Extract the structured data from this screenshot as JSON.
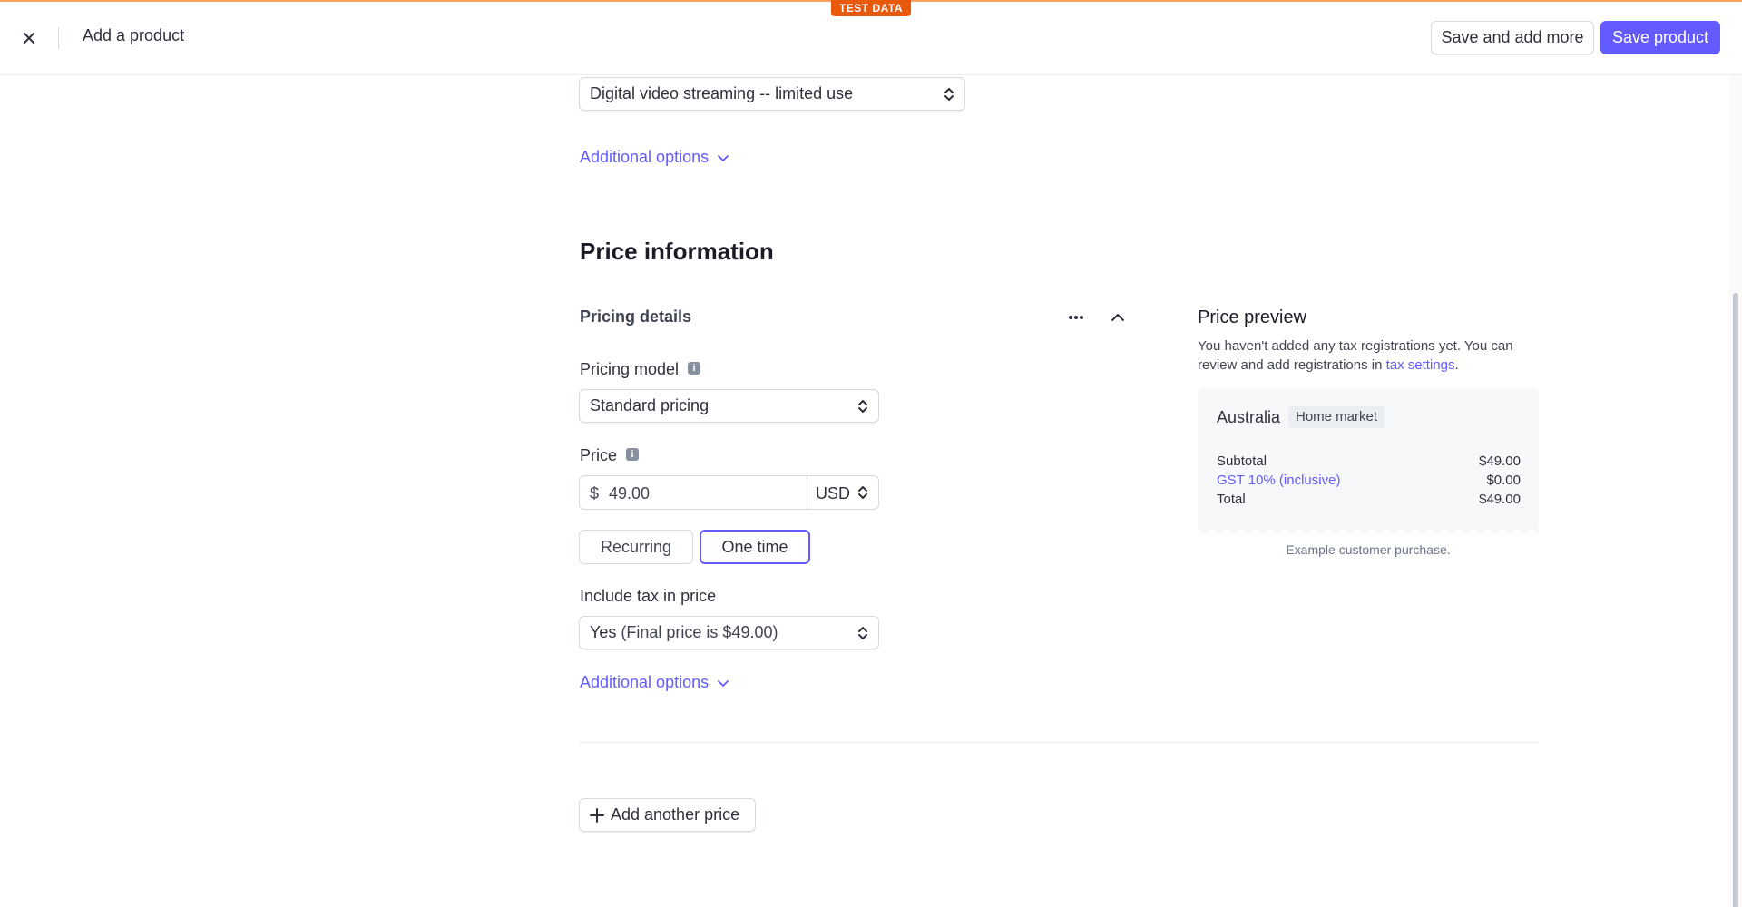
{
  "badge": {
    "test_data": "TEST DATA"
  },
  "header": {
    "title": "Add a product",
    "save_more_label": "Save and add more",
    "save_label": "Save product"
  },
  "tax_code": {
    "selected": "Digital video streaming -- limited use",
    "additional_options": "Additional options"
  },
  "price_section": {
    "title": "Price information",
    "details_title": "Pricing details",
    "pricing_model": {
      "label": "Pricing model",
      "selected": "Standard pricing"
    },
    "price": {
      "label": "Price",
      "currency_symbol": "$",
      "amount": "49.00",
      "currency": "USD"
    },
    "type_options": {
      "recurring": "Recurring",
      "one_time": "One time",
      "selected": "One time"
    },
    "include_tax": {
      "label": "Include tax in price",
      "selected_prefix": "Yes",
      "selected_detail": "(Final price is $49.00)"
    },
    "additional_options": "Additional options",
    "add_price_label": "Add another price"
  },
  "preview": {
    "title": "Price preview",
    "note_text": "You haven't added any tax registrations yet. You can review and add registrations in",
    "note_link": "tax settings",
    "note_end": ".",
    "country": "Australia",
    "market_badge": "Home market",
    "rows": [
      {
        "label": "Subtotal",
        "value": "$49.00"
      },
      {
        "label": "GST 10% (inclusive)",
        "value": "$0.00"
      },
      {
        "label": "Total",
        "value": "$49.00"
      }
    ],
    "caption": "Example customer purchase."
  },
  "colors": {
    "accent": "#635bff",
    "test_badge": "#e8590c"
  },
  "icons": {
    "close": "close-icon",
    "more": "more-icon",
    "collapse": "chevron-up-icon",
    "info": "info-icon",
    "select_caret": "updown-icon",
    "expand": "chevron-down-icon",
    "add": "plus-icon"
  }
}
